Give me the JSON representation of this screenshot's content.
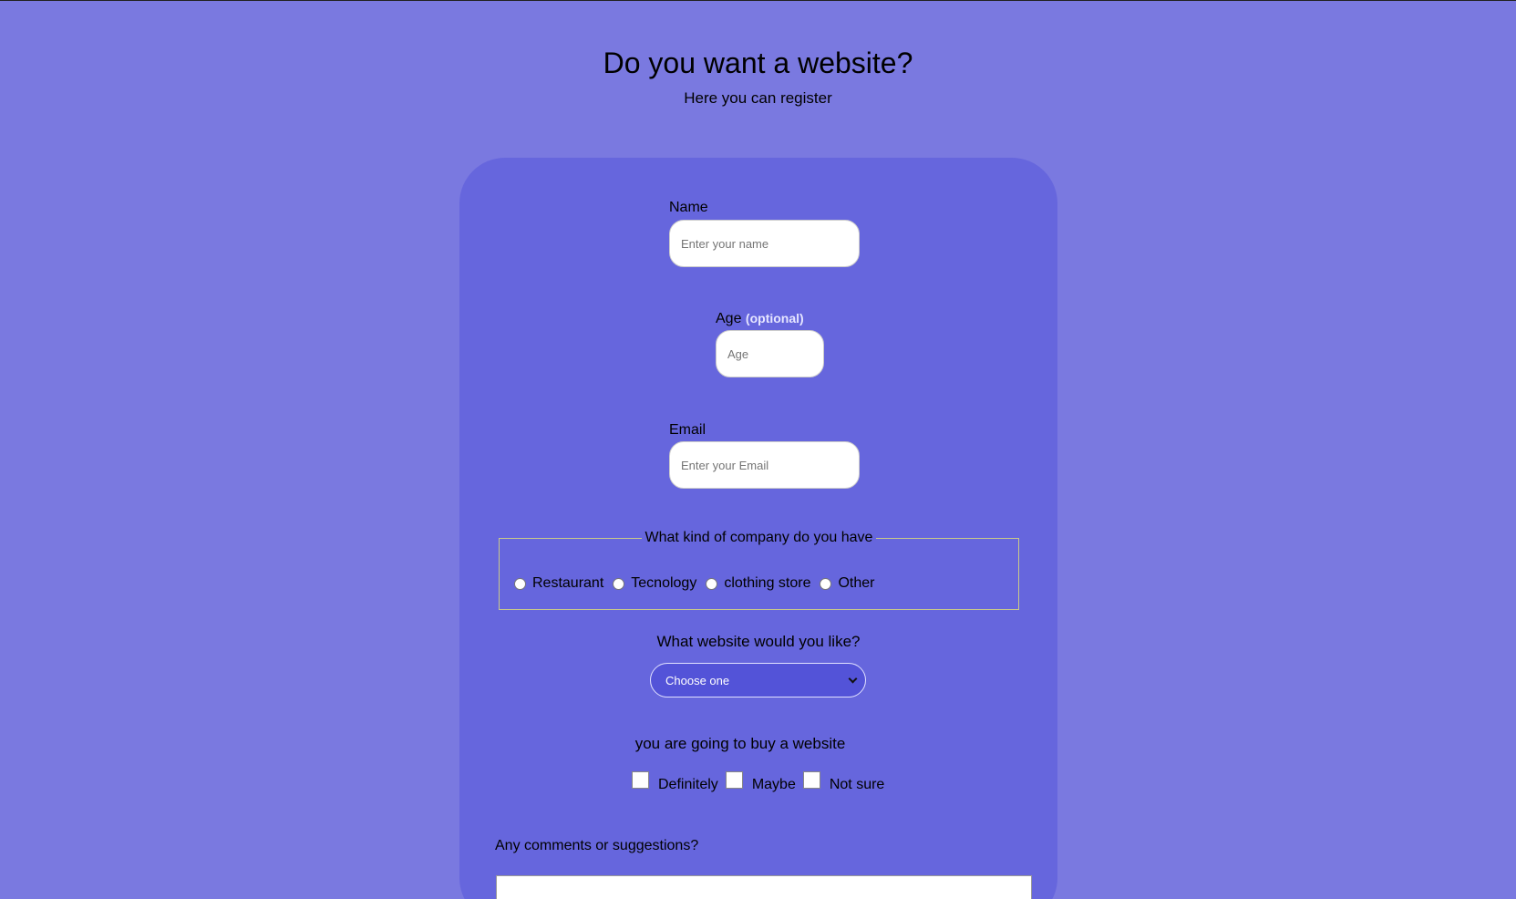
{
  "header": {
    "title": "Do you want a website?",
    "subtitle": "Here you can register"
  },
  "form": {
    "name": {
      "label": "Name",
      "placeholder": "Enter your name",
      "value": ""
    },
    "age": {
      "label": "Age",
      "optional_note": "(optional)",
      "placeholder": "Age",
      "value": ""
    },
    "email": {
      "label": "Email",
      "placeholder": "Enter your Email",
      "value": ""
    },
    "company": {
      "legend": "What kind of company do you have",
      "options": [
        "Restaurant",
        "Tecnology",
        "clothing store",
        "Other"
      ],
      "selected": null
    },
    "website": {
      "question": "What website would you like?",
      "selected_option": "Choose one"
    },
    "purchase": {
      "question": "you are going to buy a website",
      "options": [
        "Definitely",
        "Maybe",
        "Not sure"
      ],
      "checked": [
        false,
        false,
        false
      ]
    },
    "comments": {
      "label": "Any comments or suggestions?",
      "value": ""
    }
  },
  "colors": {
    "page_background": "#7a79e0",
    "card_background": "#6666dd",
    "select_background": "#5353d8"
  }
}
